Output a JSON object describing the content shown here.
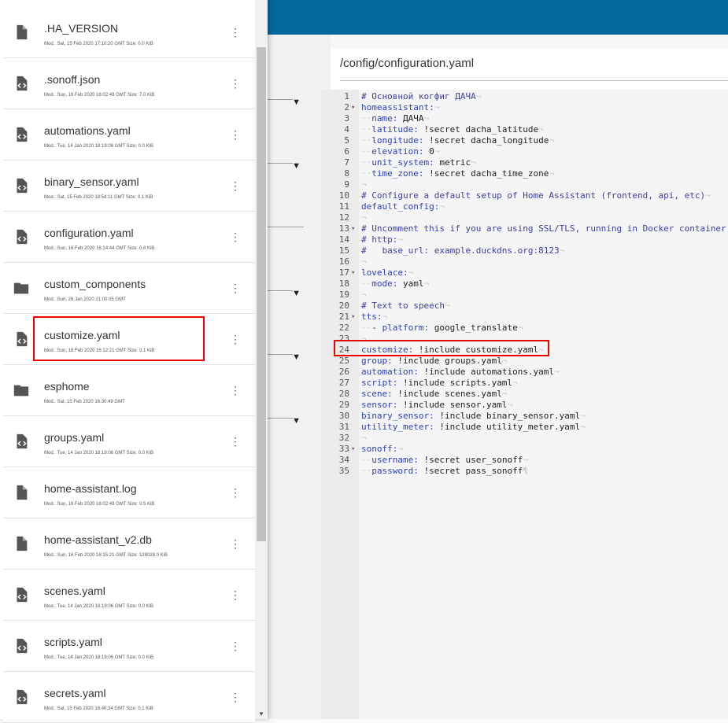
{
  "editor": {
    "path": "/config/configuration.yaml",
    "lines": [
      {
        "n": "1",
        "fold": "",
        "html": "<span class=\"c\"># Основной когфиг ДАЧА</span><span class=\"inv\">¬</span>"
      },
      {
        "n": "2",
        "fold": "▾",
        "html": "<span class=\"k\">homeassistant:</span><span class=\"inv\">¬</span>"
      },
      {
        "n": "3",
        "fold": "",
        "html": "<span class=\"inv\">··</span><span class=\"k\">name:</span> ДАЧА<span class=\"inv\">¬</span>"
      },
      {
        "n": "4",
        "fold": "",
        "html": "<span class=\"inv\">··</span><span class=\"k\">latitude:</span> !secret dacha_latitude<span class=\"inv\">¬</span>"
      },
      {
        "n": "5",
        "fold": "",
        "html": "<span class=\"inv\">··</span><span class=\"k\">longitude:</span> !secret dacha_longitude<span class=\"inv\">¬</span>"
      },
      {
        "n": "6",
        "fold": "",
        "html": "<span class=\"inv\">··</span><span class=\"k\">elevation:</span> 0<span class=\"inv\">¬</span>"
      },
      {
        "n": "7",
        "fold": "",
        "html": "<span class=\"inv\">··</span><span class=\"k\">unit_system:</span> metric<span class=\"inv\">¬</span>"
      },
      {
        "n": "8",
        "fold": "",
        "html": "<span class=\"inv\">··</span><span class=\"k\">time_zone:</span> !secret dacha_time_zone<span class=\"inv\">¬</span>"
      },
      {
        "n": "9",
        "fold": "",
        "html": "<span class=\"inv\">¬</span>"
      },
      {
        "n": "10",
        "fold": "",
        "html": "<span class=\"c\"># Configure a default setup of Home Assistant (frontend, api, etc)</span><span class=\"inv\">¬</span>"
      },
      {
        "n": "11",
        "fold": "",
        "html": "<span class=\"k\">default_config:</span><span class=\"inv\">¬</span>"
      },
      {
        "n": "12",
        "fold": "",
        "html": "<span class=\"inv\">¬</span>"
      },
      {
        "n": "13",
        "fold": "▾",
        "html": "<span class=\"c\"># Uncomment this if you are using SSL/TLS, running in Docker container, et</span>"
      },
      {
        "n": "14",
        "fold": "",
        "html": "<span class=\"c\"># http:</span><span class=\"inv\">¬</span>"
      },
      {
        "n": "15",
        "fold": "",
        "html": "<span class=\"c\">#   base_url: example.duckdns.org:8123</span><span class=\"inv\">¬</span>"
      },
      {
        "n": "16",
        "fold": "",
        "html": "<span class=\"inv\">¬</span>"
      },
      {
        "n": "17",
        "fold": "▾",
        "html": "<span class=\"k\">lovelace:</span><span class=\"inv\">¬</span>"
      },
      {
        "n": "18",
        "fold": "",
        "html": "<span class=\"inv\">··</span><span class=\"k\">mode:</span> yaml<span class=\"inv\">¬</span>"
      },
      {
        "n": "19",
        "fold": "",
        "html": "<span class=\"inv\">¬</span>"
      },
      {
        "n": "20",
        "fold": "",
        "html": "<span class=\"c\"># Text to speech</span><span class=\"inv\">¬</span>"
      },
      {
        "n": "21",
        "fold": "▾",
        "html": "<span class=\"k\">tts:</span><span class=\"inv\">¬</span>"
      },
      {
        "n": "22",
        "fold": "",
        "html": "<span class=\"inv\">··</span>- <span class=\"k\">platform:</span> google_translate<span class=\"inv\">¬</span>"
      },
      {
        "n": "23",
        "fold": "",
        "html": "<span class=\"inv\">¬</span>"
      },
      {
        "n": "24",
        "fold": "",
        "html": "<span class=\"k\">customize:</span> !include customize.yaml<span class=\"inv\">¬</span>"
      },
      {
        "n": "25",
        "fold": "",
        "html": "<span class=\"k\">group:</span> !include groups.yaml<span class=\"inv\">¬</span>"
      },
      {
        "n": "26",
        "fold": "",
        "html": "<span class=\"k\">automation:</span> !include automations.yaml<span class=\"inv\">¬</span>"
      },
      {
        "n": "27",
        "fold": "",
        "html": "<span class=\"k\">script:</span> !include scripts.yaml<span class=\"inv\">¬</span>"
      },
      {
        "n": "28",
        "fold": "",
        "html": "<span class=\"k\">scene:</span> !include scenes.yaml<span class=\"inv\">¬</span>"
      },
      {
        "n": "29",
        "fold": "",
        "html": "<span class=\"k\">sensor:</span> !include sensor.yaml<span class=\"inv\">¬</span>"
      },
      {
        "n": "30",
        "fold": "",
        "html": "<span class=\"k\">binary_sensor:</span> !include binary_sensor.yaml<span class=\"inv\">¬</span>"
      },
      {
        "n": "31",
        "fold": "",
        "html": "<span class=\"k\">utility_meter:</span> !include utility_meter.yaml<span class=\"inv\">¬</span>"
      },
      {
        "n": "32",
        "fold": "",
        "html": "<span class=\"inv\">¬</span>"
      },
      {
        "n": "33",
        "fold": "▾",
        "html": "<span class=\"k\">sonoff:</span><span class=\"inv\">¬</span>"
      },
      {
        "n": "34",
        "fold": "",
        "html": "<span class=\"inv\">··</span><span class=\"k\">username:</span> !secret user_sonoff<span class=\"inv\">¬</span>"
      },
      {
        "n": "35",
        "fold": "",
        "html": "<span class=\"inv\">··</span><span class=\"k\">password:</span> !secret pass_sonoff<span class=\"inv\">¶</span>"
      }
    ]
  },
  "files": [
    {
      "name": ".HA_VERSION",
      "meta": "Mod.: Sat, 15 Feb 2020 17:10:20 GMT  Size: 0.0 KiB",
      "icon": "file-icon"
    },
    {
      "name": ".sonoff.json",
      "meta": "Mod.: Sun, 16 Feb 2020 16:02:49 GMT  Size: 7.0 KiB",
      "icon": "code-file-icon"
    },
    {
      "name": "automations.yaml",
      "meta": "Mod.: Tue, 14 Jan 2020 18:19:06 GMT  Size: 0.0 KiB",
      "icon": "code-file-icon"
    },
    {
      "name": "binary_sensor.yaml",
      "meta": "Mod.: Sat, 15 Feb 2020 18:54:11 GMT  Size: 0.1 KiB",
      "icon": "code-file-icon"
    },
    {
      "name": "configuration.yaml",
      "meta": "Mod.: Sun, 16 Feb 2020 16:14:44 GMT  Size: 0.8 KiB",
      "icon": "code-file-icon"
    },
    {
      "name": "custom_components",
      "meta": "Mod.: Sun, 26 Jan 2020 21:00:05 GMT",
      "icon": "folder-icon"
    },
    {
      "name": "customize.yaml",
      "meta": "Mod.: Sun, 16 Feb 2020 16:12:21 GMT  Size: 0.1 KiB",
      "icon": "code-file-icon"
    },
    {
      "name": "esphome",
      "meta": "Mod.: Sat, 15 Feb 2020 16:30:49 GMT",
      "icon": "folder-icon"
    },
    {
      "name": "groups.yaml",
      "meta": "Mod.: Tue, 14 Jan 2020 18:19:06 GMT  Size: 0.0 KiB",
      "icon": "code-file-icon"
    },
    {
      "name": "home-assistant.log",
      "meta": "Mod.: Sun, 16 Feb 2020 16:02:49 GMT  Size: 0.5 KiB",
      "icon": "file-icon"
    },
    {
      "name": "home-assistant_v2.db",
      "meta": "Mod.: Sun, 16 Feb 2020 16:15:21 GMT  Size: 128028.0 KiB",
      "icon": "file-icon"
    },
    {
      "name": "scenes.yaml",
      "meta": "Mod.: Tue, 14 Jan 2020 18:19:06 GMT  Size: 0.0 KiB",
      "icon": "code-file-icon"
    },
    {
      "name": "scripts.yaml",
      "meta": "Mod.: Tue, 14 Jan 2020 18:19:06 GMT  Size: 0.0 KiB",
      "icon": "code-file-icon"
    },
    {
      "name": "secrets.yaml",
      "meta": "Mod.: Sat, 15 Feb 2020 16:40:34 GMT  Size: 0.1 KiB",
      "icon": "code-file-icon"
    }
  ],
  "file_menu_glyph": "⋮",
  "dropdown_glyph": "▼",
  "colors": {
    "topbar": "#03699c",
    "highlight": "#ee0000"
  }
}
